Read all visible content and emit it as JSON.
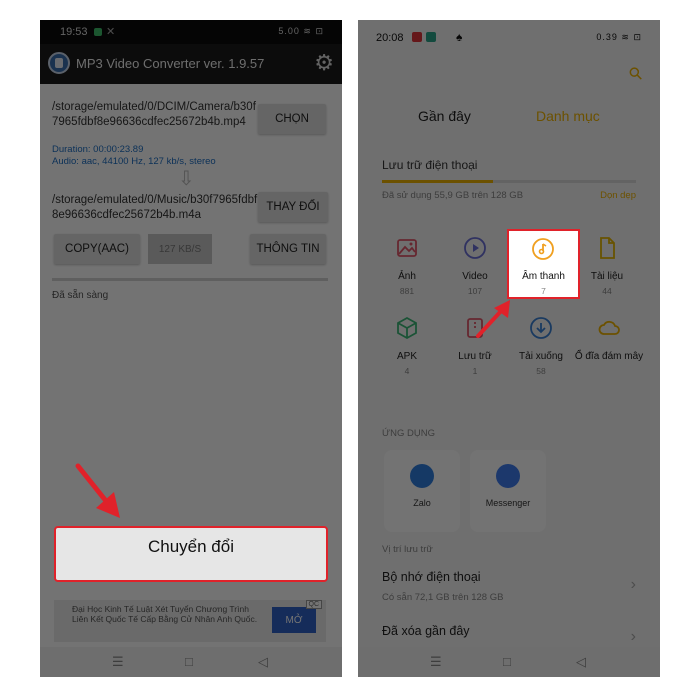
{
  "left_screen": {
    "status_time": "19:53",
    "status_indicators": "5.00 ≋ ⊡",
    "app_title": "MP3 Video Converter ver. 1.9.57",
    "settings_icon": "gear-icon",
    "source_path": "/storage/emulated/0/DCIM/Camera/b30f7965fdbf8e96636cdfec25672b4b.mp4",
    "duration": "Duration: 00:00:23.89",
    "audio_info": "Audio: aac, 44100 Hz, 127 kb/s, stereo",
    "choose_label": "CHỌN",
    "output_path": "/storage/emulated/0/Music/b30f7965fdbf8e96636cdfec25672b4b.m4a",
    "change_label": "THAY ĐỔI",
    "format_label": "COPY(AAC)",
    "bitrate_label": "127 KB/S",
    "info_label": "THÔNG TIN",
    "ready_status": "Đã sẵn sàng",
    "convert_label": "Chuyển đổi",
    "ad_text": "Đại Học Kinh Tế Luật Xét Tuyển Chương Trình Liên Kết Quốc Tế Cấp Bằng Cử Nhân Anh Quốc.",
    "ad_button": "MỞ",
    "ad_badge": "QC"
  },
  "right_screen": {
    "status_time": "20:08",
    "status_indicators": "0.39 ≋ ⊡",
    "tabs": [
      {
        "label": "Gần đây",
        "active": false
      },
      {
        "label": "Danh mục",
        "active": true
      }
    ],
    "storage_title": "Lưu trữ điện thoại",
    "storage_used_text": "Đã sử dụng 55,9 GB trên 128 GB",
    "storage_used_fraction": 0.437,
    "clean_label": "Dọn dẹp",
    "categories": [
      {
        "name": "Ảnh",
        "count": "881",
        "icon": "image-icon"
      },
      {
        "name": "Video",
        "count": "107",
        "icon": "video-play-icon"
      },
      {
        "name": "Âm thanh",
        "count": "7",
        "icon": "music-note-icon"
      },
      {
        "name": "Tài liệu",
        "count": "44",
        "icon": "document-icon"
      },
      {
        "name": "APK",
        "count": "4",
        "icon": "apk-box-icon"
      },
      {
        "name": "Lưu trữ",
        "count": "1",
        "icon": "archive-icon"
      },
      {
        "name": "Tải xuống",
        "count": "58",
        "icon": "download-icon"
      },
      {
        "name": "Ổ đĩa đám mây",
        "count": "",
        "icon": "cloud-icon"
      }
    ],
    "apps_label": "ỨNG DỤNG",
    "apps": [
      {
        "name": "Zalo",
        "icon": "zalo-icon"
      },
      {
        "name": "Messenger",
        "icon": "messenger-icon"
      }
    ],
    "location_label": "Vị trí lưu trữ",
    "phone_memory": "Bộ nhớ điện thoại",
    "phone_memory_sub": "Có sẵn 72,1 GB trên 128 GB",
    "recently_deleted": "Đã xóa gần đây"
  },
  "colors": {
    "highlight": "#e0222a",
    "accent": "#f0b400",
    "ad_button": "#2f63c8",
    "meta_text": "#1e6fc4"
  }
}
